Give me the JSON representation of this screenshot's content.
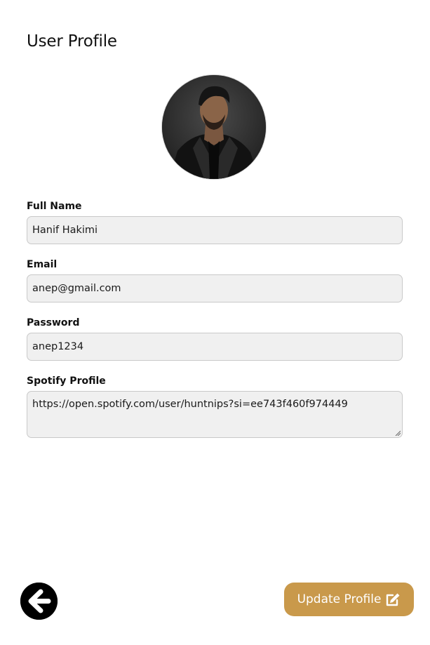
{
  "page": {
    "title": "User Profile"
  },
  "form": {
    "full_name": {
      "label": "Full Name",
      "value": "Hanif Hakimi"
    },
    "email": {
      "label": "Email",
      "value": "anep@gmail.com"
    },
    "password": {
      "label": "Password",
      "value": "anep1234"
    },
    "spotify": {
      "label": "Spotify Profile",
      "value": "https://open.spotify.com/user/huntnips?si=ee743f460f974449"
    }
  },
  "actions": {
    "back_icon": "arrow-left-circle-icon",
    "update_label": "Update Profile",
    "update_icon": "edit-square-icon"
  },
  "colors": {
    "accent": "#c9994b",
    "input_bg": "#f0f0f0",
    "back_button": "#000000"
  }
}
